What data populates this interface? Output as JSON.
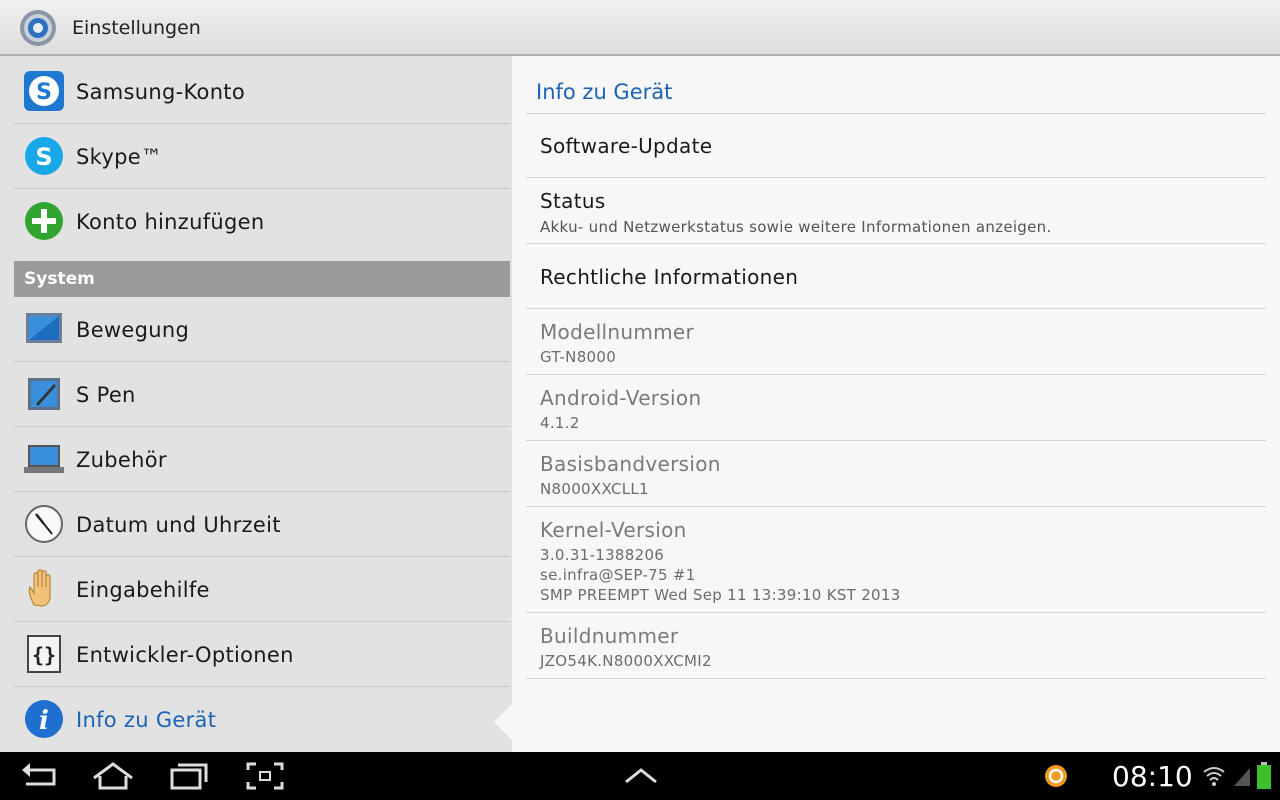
{
  "app": {
    "title": "Einstellungen"
  },
  "left": {
    "items_top": [
      {
        "label": "Samsung-Konto",
        "icon": "samsung-account-icon"
      },
      {
        "label": "Skype™",
        "icon": "skype-icon"
      },
      {
        "label": "Konto hinzufügen",
        "icon": "add-account-icon"
      }
    ],
    "section": "System",
    "items_system": [
      {
        "label": "Bewegung",
        "icon": "motion-icon"
      },
      {
        "label": "S Pen",
        "icon": "s-pen-icon"
      },
      {
        "label": "Zubehör",
        "icon": "accessory-icon"
      },
      {
        "label": "Datum und Uhrzeit",
        "icon": "clock-icon"
      },
      {
        "label": "Eingabehilfe",
        "icon": "hand-icon"
      },
      {
        "label": "Entwickler-Optionen",
        "icon": "developer-braces-icon"
      },
      {
        "label": "Info zu Gerät",
        "icon": "info-icon"
      }
    ]
  },
  "right": {
    "title": "Info zu Gerät",
    "items": [
      {
        "title": "Software-Update"
      },
      {
        "title": "Status",
        "summary": "Akku- und Netzwerkstatus sowie weitere Informationen anzeigen."
      },
      {
        "title": "Rechtliche Informationen"
      },
      {
        "title": "Modellnummer",
        "value": "GT-N8000"
      },
      {
        "title": "Android-Version",
        "value": "4.1.2"
      },
      {
        "title": "Basisbandversion",
        "value": "N8000XXCLL1"
      },
      {
        "title": "Kernel-Version",
        "line1": "3.0.31-1388206",
        "line2": "se.infra@SEP-75 #1",
        "line3": "SMP PREEMPT Wed Sep 11 13:39:10 KST 2013"
      },
      {
        "title": "Buildnummer",
        "value": "JZO54K.N8000XXCMI2"
      }
    ]
  },
  "statusbar": {
    "time": "08:10"
  },
  "colors": {
    "accent": "#1b64b5",
    "section_bg": "#9a9a9a",
    "left_bg": "#e2e2e2",
    "right_bg": "#f7f7f7"
  }
}
